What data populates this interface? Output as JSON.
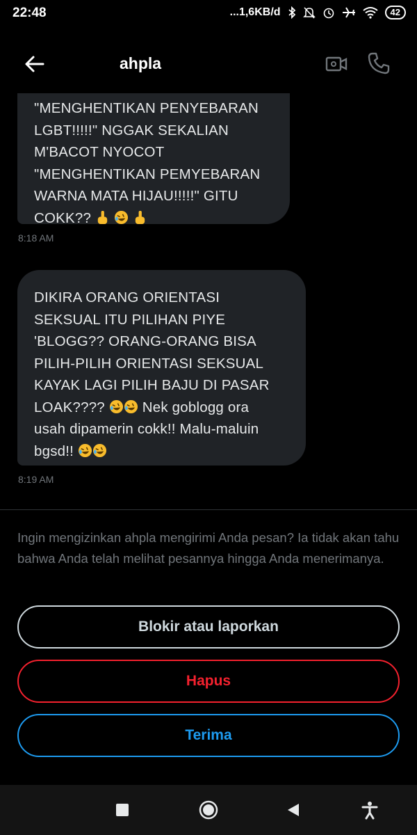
{
  "status_bar": {
    "time": "22:48",
    "network_speed": "...1,6KB/d",
    "battery": "42",
    "icons": [
      "bluetooth-icon",
      "mute-icon",
      "alarm-icon",
      "airplane-icon",
      "wifi-icon",
      "battery-icon"
    ]
  },
  "header": {
    "title": "ahpla",
    "icons": [
      "back-arrow-icon",
      "video-call-icon",
      "phone-call-icon"
    ]
  },
  "messages": [
    {
      "text": "\"MENGHENTIKAN PENYEBARAN\nLGBT!!!!!\" NGGAK SEKALIAN\nM'BACOT NYOCOT\n\"MENGHENTIKAN PEMYEBARAN\nWARNA MATA HIJAU!!!!!\" GITU\nCOKK??",
      "emoji": [
        "middle-finger-emoji",
        "rolling-laughing-emoji",
        "middle-finger-emoji"
      ],
      "time": "8:18 AM"
    },
    {
      "text_before": "DIKIRA ORANG ORIENTASI\nSEKSUAL ITU PILIHAN PIYE\n'BLOGG?? ORANG-ORANG BISA\nPILIH-PILIH ORIENTASI SEKSUAL\nKAYAK LAGI PILIH BAJU DI PASAR\nLOAK????",
      "text_after": " Nek goblogg ora\nusah dipamerin cokk!! Malu-maluin\nbgsd!!",
      "emoji": [
        "rolling-laughing-emoji",
        "rolling-laughing-emoji"
      ],
      "time": "8:19 AM"
    }
  ],
  "request": {
    "prompt": "Ingin mengizinkan ahpla mengirimi Anda pesan? Ia tidak akan tahu bahwa Anda telah melihat pesannya hingga Anda menerimanya.",
    "block_label": "Blokir atau laporkan",
    "delete_label": "Hapus",
    "accept_label": "Terima"
  },
  "colors": {
    "background": "#000000",
    "bubble": "#202327",
    "muted_text": "#71767b",
    "danger": "#f4212e",
    "accent": "#1d9bf0"
  },
  "navbar": {
    "icons": [
      "recent-apps-icon",
      "home-icon",
      "back-icon",
      "accessibility-icon"
    ]
  }
}
